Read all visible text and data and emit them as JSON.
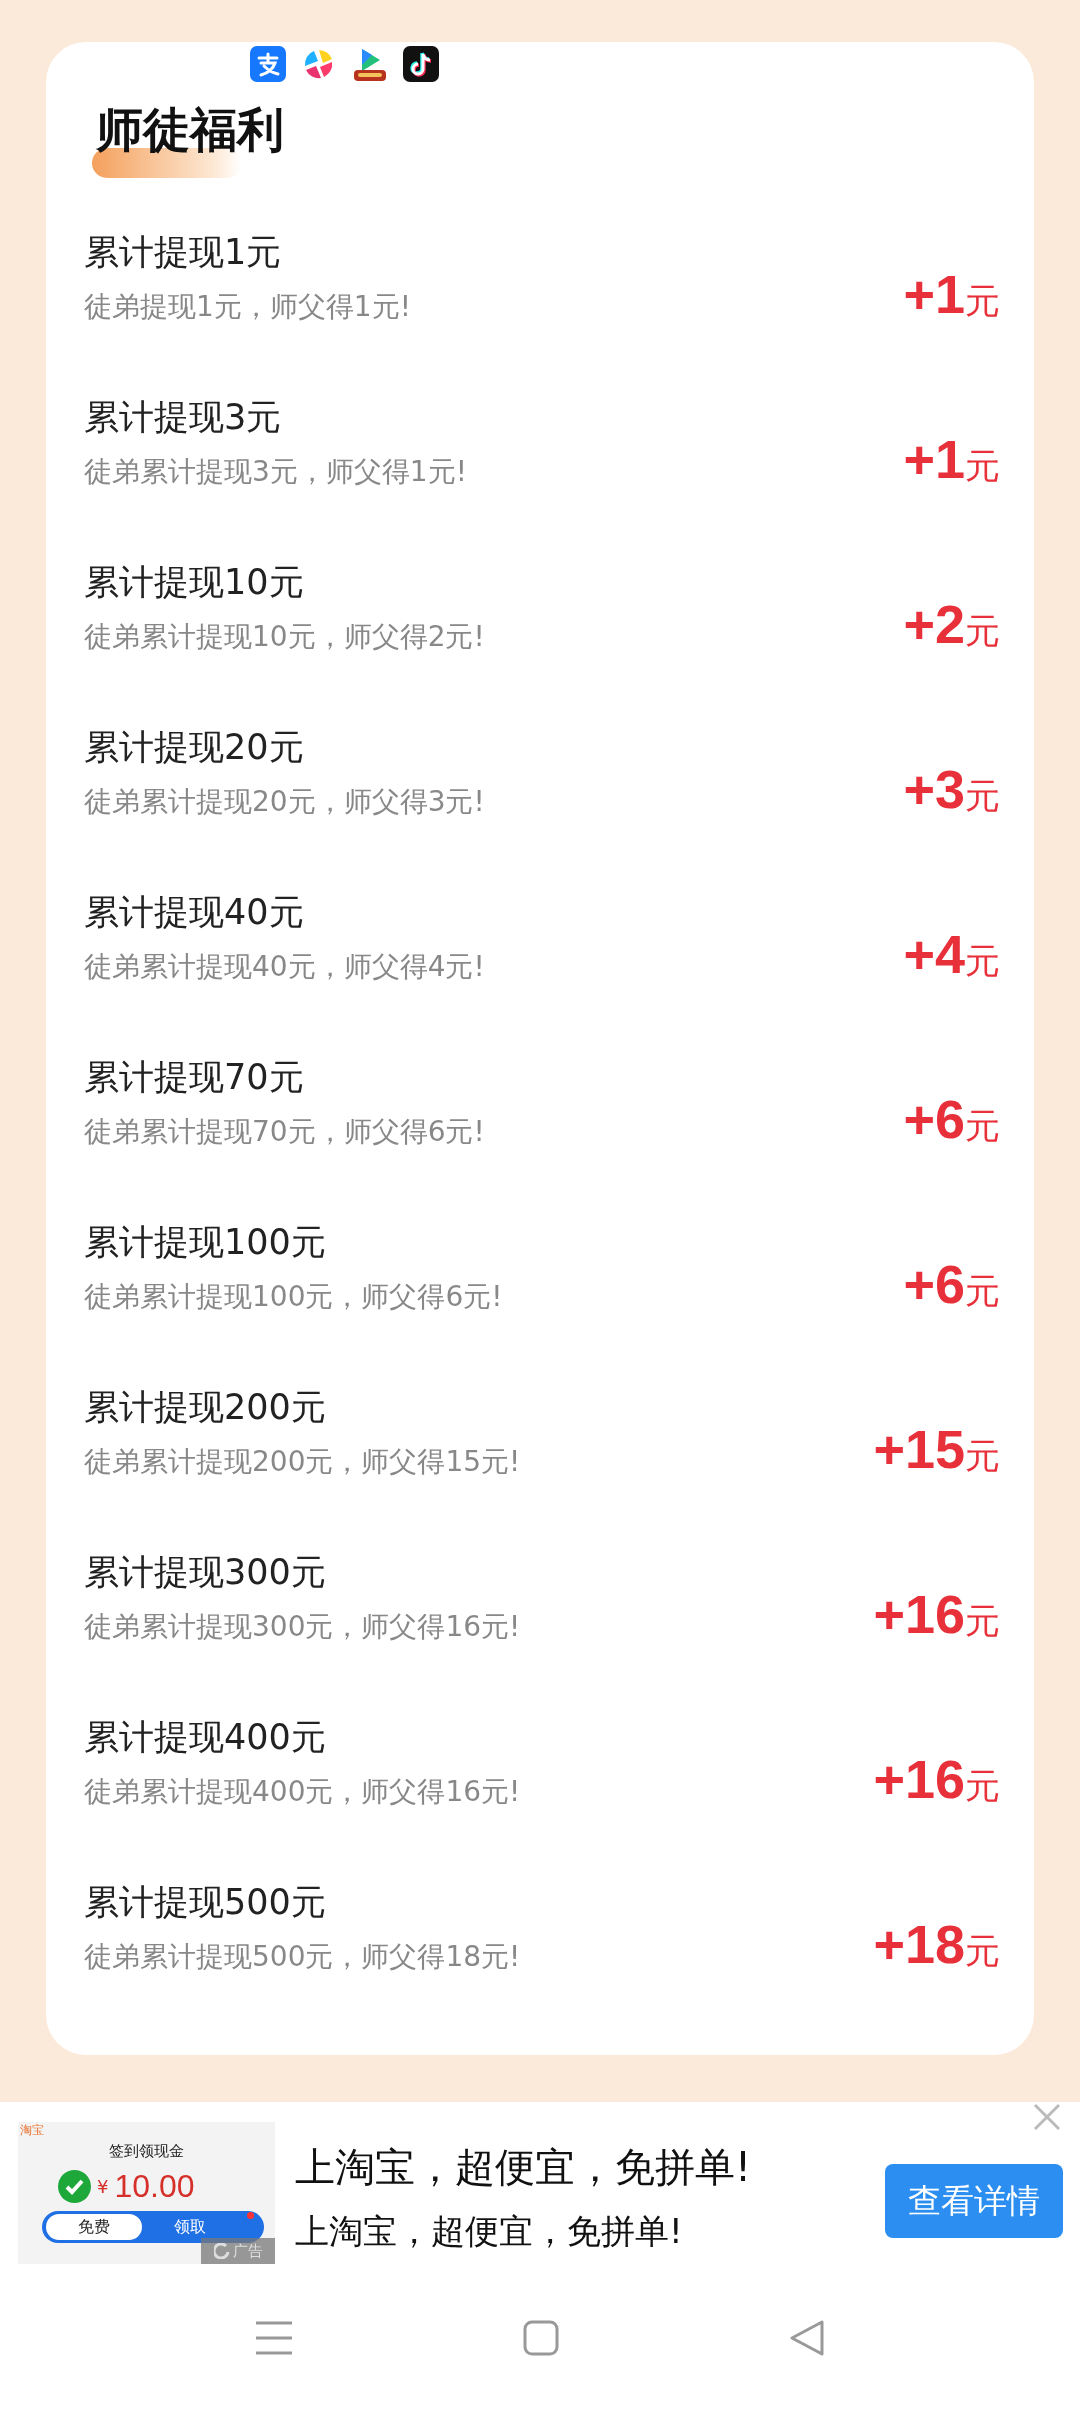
{
  "app_icons": [
    {
      "kind": "pay"
    },
    {
      "kind": "pinwheel"
    },
    {
      "kind": "play"
    },
    {
      "kind": "note"
    }
  ],
  "title": "师徒福利",
  "rewards": [
    {
      "title": "累计提现1元",
      "description": "徒弟提现1元，师父得1元!",
      "amount": "+1",
      "unit": "元"
    },
    {
      "title": "累计提现3元",
      "description": "徒弟累计提现3元，师父得1元!",
      "amount": "+1",
      "unit": "元"
    },
    {
      "title": "累计提现10元",
      "description": "徒弟累计提现10元，师父得2元!",
      "amount": "+2",
      "unit": "元"
    },
    {
      "title": "累计提现20元",
      "description": "徒弟累计提现20元，师父得3元!",
      "amount": "+3",
      "unit": "元"
    },
    {
      "title": "累计提现40元",
      "description": "徒弟累计提现40元，师父得4元!",
      "amount": "+4",
      "unit": "元"
    },
    {
      "title": "累计提现70元",
      "description": "徒弟累计提现70元，师父得6元!",
      "amount": "+6",
      "unit": "元"
    },
    {
      "title": "累计提现100元",
      "description": "徒弟累计提现100元，师父得6元!",
      "amount": "+6",
      "unit": "元"
    },
    {
      "title": "累计提现200元",
      "description": "徒弟累计提现200元，师父得15元!",
      "amount": "+15",
      "unit": "元"
    },
    {
      "title": "累计提现300元",
      "description": "徒弟累计提现300元，师父得16元!",
      "amount": "+16",
      "unit": "元"
    },
    {
      "title": "累计提现400元",
      "description": "徒弟累计提现400元，师父得16元!",
      "amount": "+16",
      "unit": "元"
    },
    {
      "title": "累计提现500元",
      "description": "徒弟累计提现500元，师父得18元!",
      "amount": "+18",
      "unit": "元"
    }
  ],
  "ad": {
    "thumbnail": {
      "brand": "淘宝",
      "caption": "签到领现金",
      "currency": "¥",
      "amount": "10.00",
      "left_pill": "免费",
      "right_pill": "领取",
      "ad_tag": "广告"
    },
    "headline": "上淘宝，超便宜，免拼单!",
    "subline": "上淘宝，超便宜，免拼单!",
    "button": "查看详情"
  }
}
